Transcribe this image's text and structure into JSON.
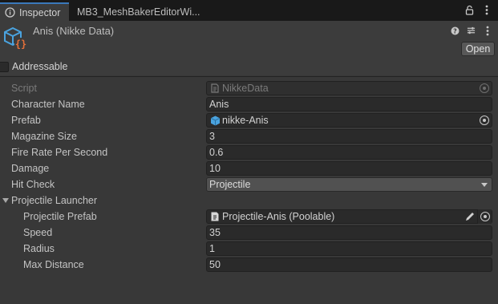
{
  "tabs": [
    {
      "label": "Inspector",
      "icon": "info-icon",
      "active": true
    },
    {
      "label": "MB3_MeshBakerEditorWi...",
      "active": false
    }
  ],
  "tab_tools": [
    "lock-icon",
    "kebab-menu-icon"
  ],
  "header": {
    "title": "Anis (Nikke Data)",
    "icon": "scriptable-object-icon",
    "tools": [
      "help-icon",
      "presets-icon",
      "kebab-menu-icon"
    ],
    "open_label": "Open"
  },
  "addressable": {
    "label": "Addressable",
    "checked": false
  },
  "properties": [
    {
      "label": "Script",
      "value": "NikkeData",
      "icon": "script-icon",
      "disabled": true,
      "kind": "object"
    },
    {
      "label": "Character Name",
      "value": "Anis",
      "kind": "text"
    },
    {
      "label": "Prefab",
      "value": "nikke-Anis",
      "icon": "prefab-cube-icon",
      "kind": "object"
    },
    {
      "label": "Magazine Size",
      "value": "3",
      "kind": "number"
    },
    {
      "label": "Fire Rate Per Second",
      "value": "0.6",
      "kind": "number"
    },
    {
      "label": "Damage",
      "value": "10",
      "kind": "number"
    },
    {
      "label": "Hit Check",
      "value": "Projectile",
      "kind": "enum"
    },
    {
      "label": "Projectile Launcher",
      "kind": "foldout",
      "expanded": true
    },
    {
      "label": "Projectile Prefab",
      "value": "Projectile-Anis (Poolable)",
      "icon": "script-icon",
      "kind": "object-edit"
    },
    {
      "label": "Speed",
      "value": "35",
      "kind": "number"
    },
    {
      "label": "Radius",
      "value": "1",
      "kind": "number"
    },
    {
      "label": "Max Distance",
      "value": "50",
      "kind": "number"
    }
  ],
  "colors": {
    "background": "#383838",
    "field": "#2a2a2a",
    "accent_tab": "#3a79bb",
    "object_icon_blue": "#4aa3df",
    "object_icon_orange": "#e4703a"
  }
}
